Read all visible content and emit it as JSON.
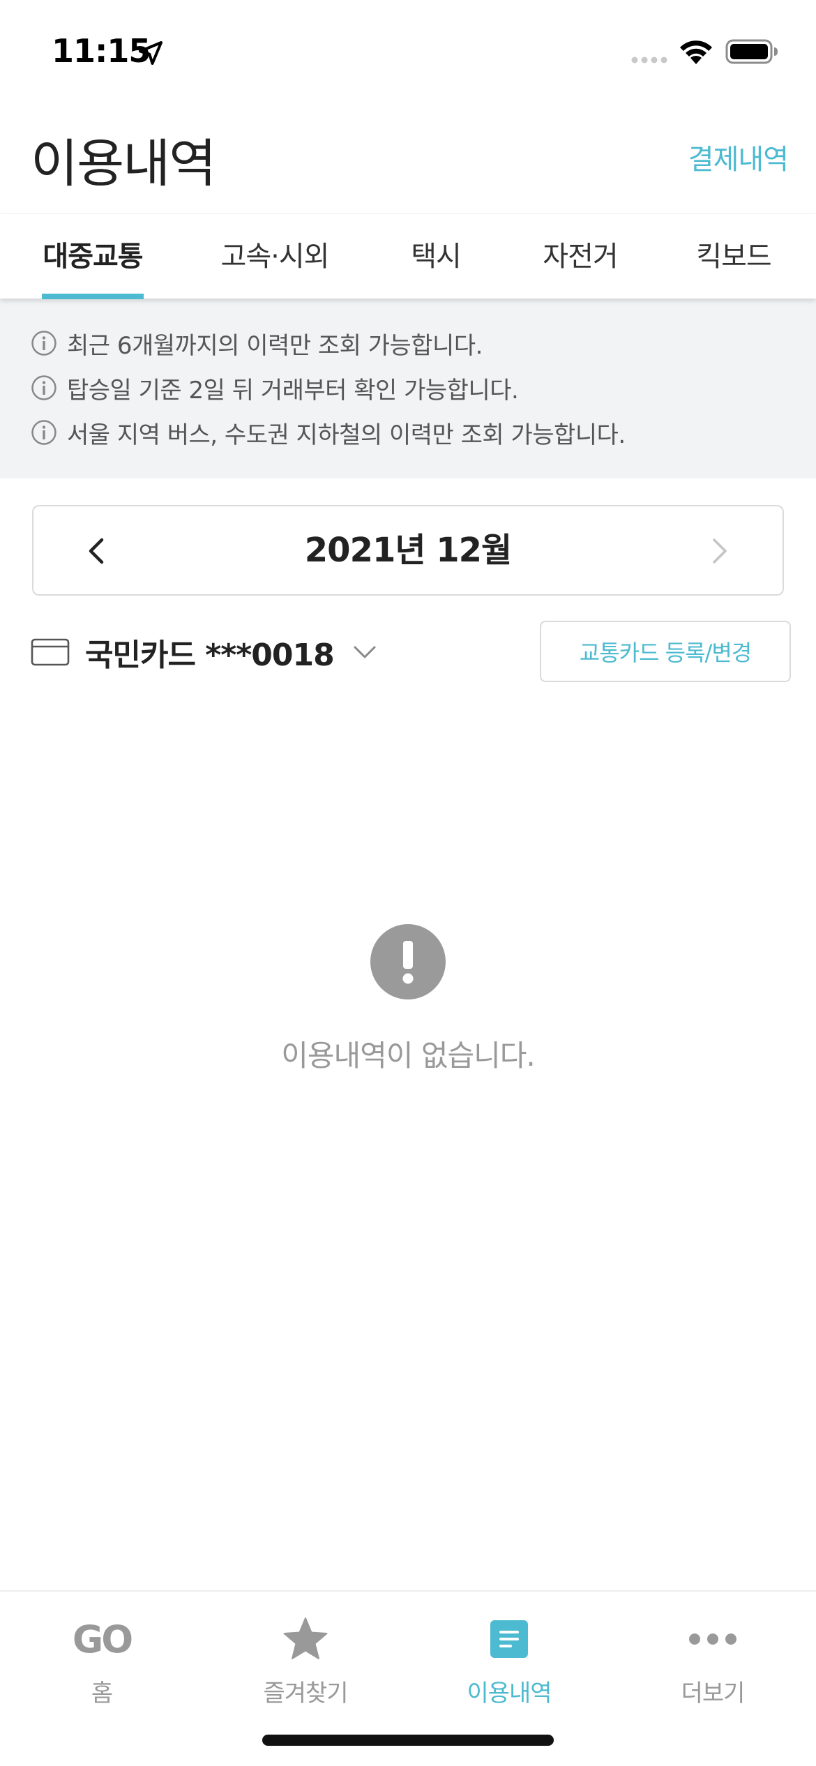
{
  "status_bar": {
    "time": "11:15"
  },
  "header": {
    "title": "이용내역",
    "payment_link": "결제내역"
  },
  "tabs": [
    {
      "label": "대중교통",
      "active": true
    },
    {
      "label": "고속·시외",
      "active": false
    },
    {
      "label": "택시",
      "active": false
    },
    {
      "label": "자전거",
      "active": false
    },
    {
      "label": "킥보드",
      "active": false
    }
  ],
  "notices": [
    "최근 6개월까지의 이력만 조회 가능합니다.",
    "탑승일 기준 2일 뒤 거래부터 확인 가능합니다.",
    "서울 지역 버스, 수도권 지하철의 이력만 조회 가능합니다."
  ],
  "month_selector": {
    "label": "2021년 12월"
  },
  "card": {
    "name": "국민카드 ***0018",
    "register_label": "교통카드 등록/변경"
  },
  "empty_state": {
    "message": "이용내역이 없습니다."
  },
  "bottom_nav": [
    {
      "label": "홈",
      "icon": "go-logo-icon",
      "icon_text": "GO",
      "active": false
    },
    {
      "label": "즐겨찾기",
      "icon": "star-icon",
      "active": false
    },
    {
      "label": "이용내역",
      "icon": "document-icon",
      "active": true
    },
    {
      "label": "더보기",
      "icon": "more-icon",
      "active": false
    }
  ],
  "colors": {
    "accent": "#4cbad0",
    "notice_bg": "#f2f3f5",
    "muted": "#999999"
  }
}
